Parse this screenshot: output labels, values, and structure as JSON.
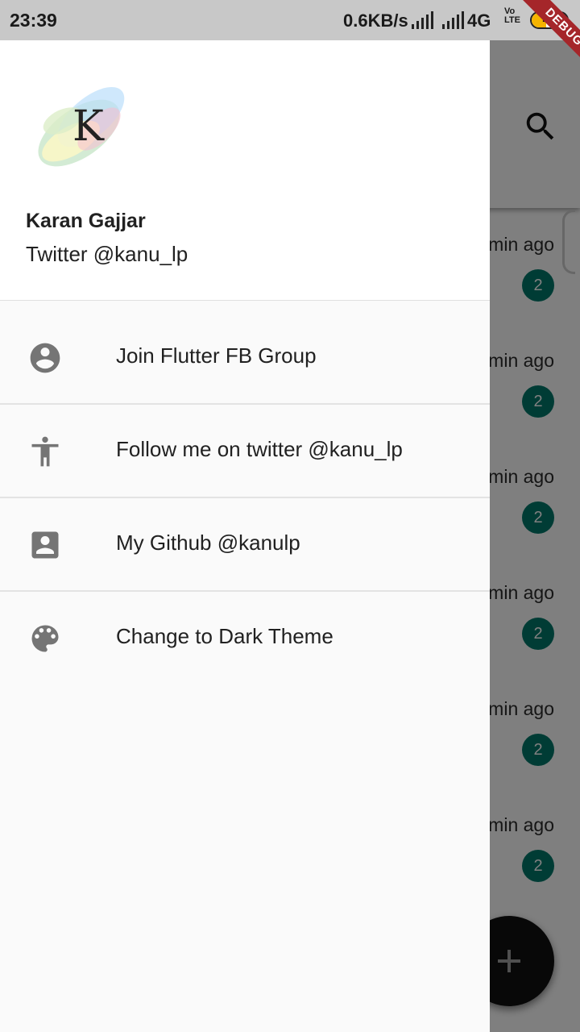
{
  "status_bar": {
    "time": "23:39",
    "net_speed": "0.6KB/s",
    "network_type": "4G",
    "volte_line1": "Vo",
    "volte_line2": "LTE",
    "battery": "42"
  },
  "debug_banner": "DEBUG",
  "background_list": {
    "rows": [
      {
        "time": "min ago",
        "badge": "2"
      },
      {
        "time": "min ago",
        "badge": "2"
      },
      {
        "time": "min ago",
        "badge": "2"
      },
      {
        "time": "min ago",
        "badge": "2"
      },
      {
        "time": "min ago",
        "badge": "2"
      },
      {
        "time": "min ago",
        "badge": "2"
      }
    ]
  },
  "drawer": {
    "avatar_letter": "K",
    "account_name": "Karan Gajjar",
    "account_handle": "Twitter @kanu_lp",
    "items": [
      {
        "label": "Join Flutter FB Group",
        "icon": "account-circle-icon"
      },
      {
        "label": "Follow me on twitter @kanu_lp",
        "icon": "accessibility-icon"
      },
      {
        "label": "My Github @kanulp",
        "icon": "contact-card-icon"
      },
      {
        "label": "Change to Dark Theme",
        "icon": "palette-icon"
      }
    ]
  },
  "colors": {
    "badge": "#00796b",
    "fab": "#111111",
    "icon_gray": "#757575",
    "debug_ribbon": "#a5262a"
  }
}
